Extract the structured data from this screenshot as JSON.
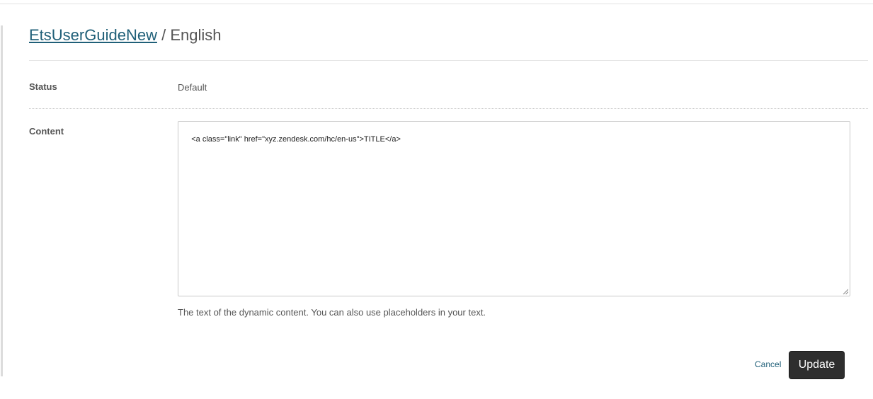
{
  "header": {
    "link": "EtsUserGuideNew",
    "separator": "/",
    "language": "English"
  },
  "status": {
    "label": "Status",
    "value": "Default"
  },
  "content": {
    "label": "Content",
    "value": "<a class=\"link\" href=\"xyz.zendesk.com/hc/en-us\">TITLE</a>",
    "hint": "The text of the dynamic content. You can also use placeholders in your text."
  },
  "actions": {
    "cancel_label": "Cancel",
    "update_label": "Update"
  },
  "colors": {
    "link": "#1f5f78",
    "button": "#2e2e2e"
  }
}
